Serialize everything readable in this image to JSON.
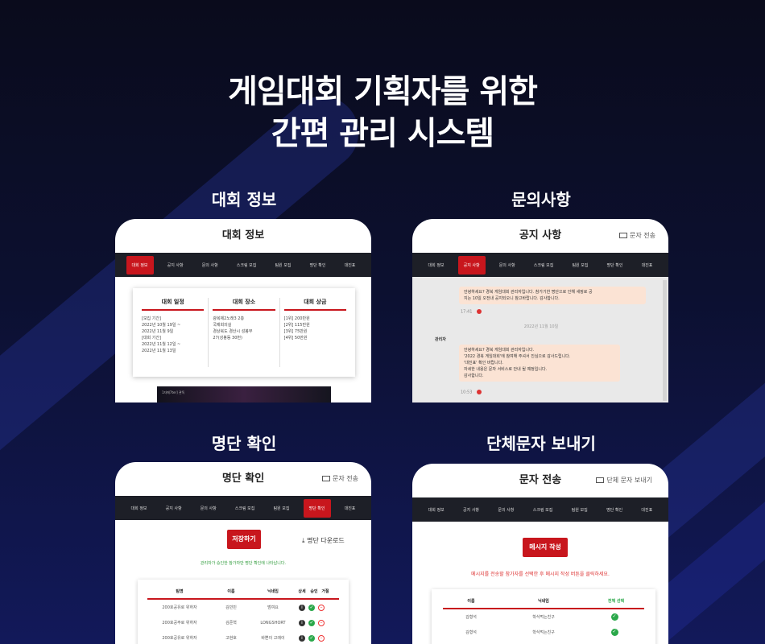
{
  "headline": {
    "line1": "게임대회 기획자를 위한",
    "line2": "간편 관리 시스템"
  },
  "sections": {
    "info": "대회 정보",
    "inquiry": "문의사항",
    "roster": "명단 확인",
    "sms": "단체문자 보내기"
  },
  "nav": [
    "대회 정보",
    "공지 사항",
    "문의 사항",
    "스크림 모집",
    "팀원 모집",
    "명단 확인",
    "대진표"
  ],
  "card1": {
    "title": "대회 정보",
    "cols": [
      {
        "h": "대회 일정",
        "lines": [
          "[모집 기간]",
          "2022년 10월 19일 ~",
          "2022년 11월 9일",
          "[대회 기간]",
          "2022년 11월 12일 ~",
          "2022년 11월 13일"
        ]
      },
      {
        "h": "대회 장소",
        "lines": [
          "광복제2노래3 2층",
          "국제회의실",
          "경상북도 경산시 성봉부",
          "27(성봉동 30번)"
        ]
      },
      {
        "h": "대회 상금",
        "lines": [
          "[1위] 200만원",
          "[2위] 115만원",
          "[3위] 75만원",
          "[4위] 50만원"
        ]
      }
    ],
    "banner": "1자메7ter] 관독"
  },
  "card2": {
    "title": "공지 사항",
    "send": "문자 전송",
    "bubble1": [
      "안녕하세요? 경북 게임대회 관리자입니다. 참가기한 명단으로 인해 새정로 공",
      "지는 10일 오전내 공지되오니 참고바랍니다. 감사합니다."
    ],
    "time1": "17:41",
    "date": "2022년 11월 10일",
    "sender": "관리자",
    "bubble2": [
      "안녕하세요? 경북 게임대회 관리자입니다.",
      "'2022 경북 게임대회'에 참여해 주셔서 진심으로 감사드립니다.",
      "'대진표' 확인 바랍니다.",
      "자세한 내용은 문자 서비스로 안내 될 예정입니다.",
      "감사합니다."
    ],
    "time2": "10:53"
  },
  "card3": {
    "title": "명단 확인",
    "send": "문자 전송",
    "save": "저장하기",
    "download": "명단 다운로드",
    "note": "관리자가 승인한 참가자만 명단 확인에 나타납니다.",
    "headers": [
      "팀명",
      "이름",
      "닉네임",
      "상세",
      "승인",
      "거절"
    ],
    "rows": [
      [
        "200호공유로 위하자",
        "김민민",
        "범여요"
      ],
      [
        "200호공주로 위하자",
        "김준혁",
        "LONGSHORT"
      ],
      [
        "200호공유로 위하자",
        "고현호",
        "바쁜이 고래이"
      ]
    ]
  },
  "card4": {
    "title": "문자 전송",
    "send": "단체 문자 보내기",
    "compose": "메시지 작성",
    "note": "메시지를 전송할 참가자를 선택한 후 메시지 작성 버튼을 클릭하세요.",
    "headers": [
      "이름",
      "닉네임",
      "전체 선택"
    ],
    "rows": [
      [
        "김형석",
        "학식먹는친구"
      ],
      [
        "김형석",
        "학식먹는친구"
      ]
    ]
  },
  "colors": {
    "accent": "#c8161d",
    "nav": "#1d1f27",
    "ok": "#2aa84a"
  }
}
